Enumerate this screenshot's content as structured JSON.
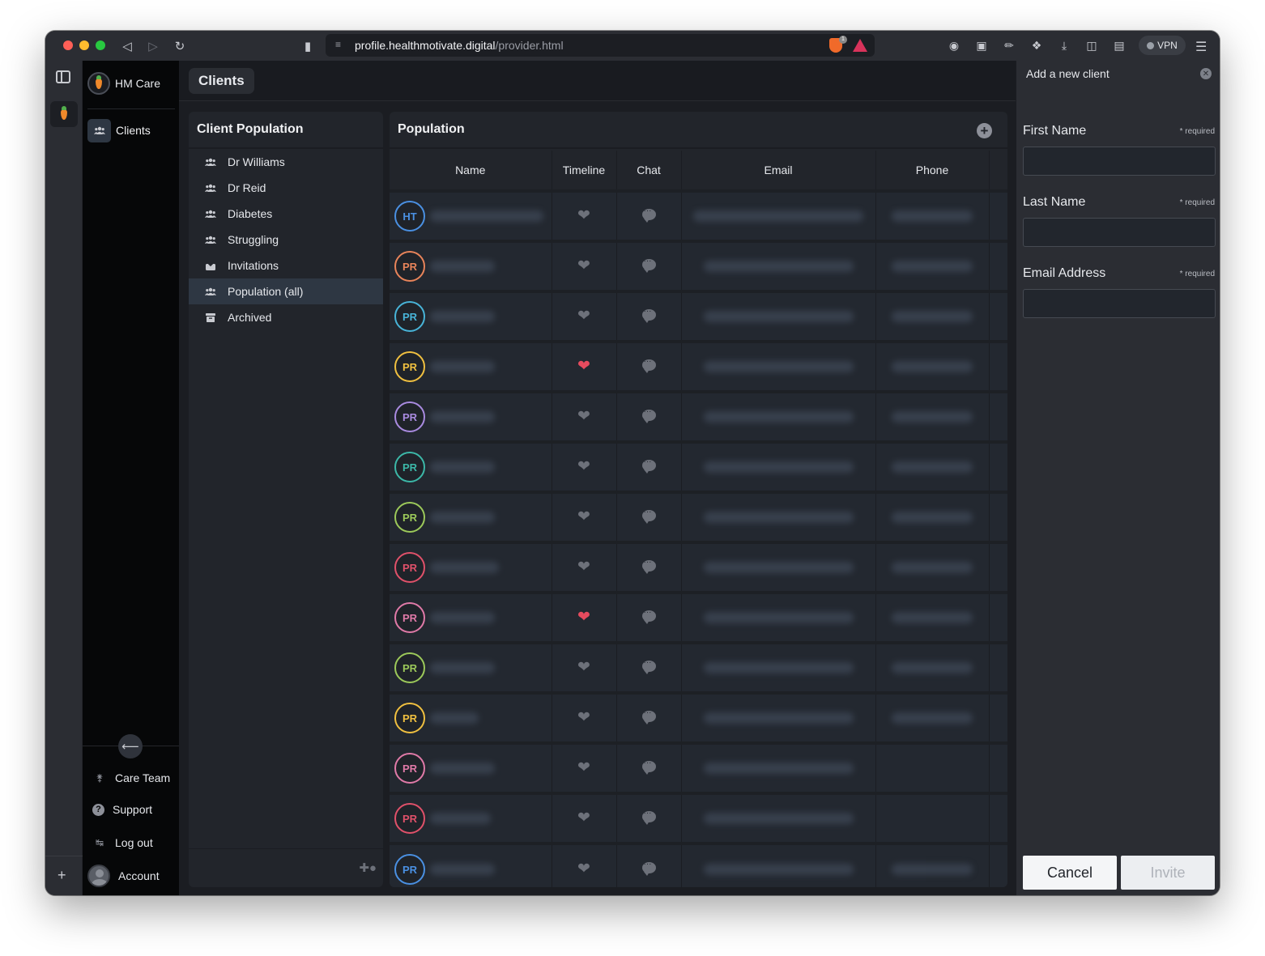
{
  "browser": {
    "url_host": "profile.healthmotivate.digital",
    "url_path": "/provider.html",
    "shield_count": "1",
    "vpn_label": "VPN"
  },
  "nav": {
    "brand": "HM Care",
    "clients": "Clients",
    "bottom": [
      {
        "label": "Care Team",
        "icon": "key-icon"
      },
      {
        "label": "Support",
        "icon": "help-icon"
      },
      {
        "label": "Log out",
        "icon": "logout-icon"
      },
      {
        "label": "Account",
        "icon": "avatar"
      }
    ]
  },
  "page": {
    "title": "Clients"
  },
  "client_population": {
    "title": "Client Population",
    "items": [
      {
        "label": "Dr Williams",
        "icon": "group-icon",
        "active": false
      },
      {
        "label": "Dr Reid",
        "icon": "group-icon",
        "active": false
      },
      {
        "label": "Diabetes",
        "icon": "group-icon",
        "active": false
      },
      {
        "label": "Struggling",
        "icon": "group-icon",
        "active": false
      },
      {
        "label": "Invitations",
        "icon": "inbox-icon",
        "active": false
      },
      {
        "label": "Population (all)",
        "icon": "group-icon",
        "active": true
      },
      {
        "label": "Archived",
        "icon": "archive-icon",
        "active": false
      }
    ]
  },
  "population": {
    "title": "Population",
    "columns": [
      "Name",
      "Timeline",
      "Chat",
      "Email",
      "Phone"
    ],
    "rows": [
      {
        "initials": "HT",
        "color": "#4a90e2",
        "timeline_active": false,
        "has_phone": true
      },
      {
        "initials": "PR",
        "color": "#e8845a",
        "timeline_active": false,
        "has_phone": true
      },
      {
        "initials": "PR",
        "color": "#48b4d8",
        "timeline_active": false,
        "has_phone": true
      },
      {
        "initials": "PR",
        "color": "#f0c040",
        "timeline_active": true,
        "has_phone": true
      },
      {
        "initials": "PR",
        "color": "#a98be0",
        "timeline_active": false,
        "has_phone": true
      },
      {
        "initials": "PR",
        "color": "#3cb8a8",
        "timeline_active": false,
        "has_phone": true
      },
      {
        "initials": "PR",
        "color": "#9cc95a",
        "timeline_active": false,
        "has_phone": true
      },
      {
        "initials": "PR",
        "color": "#e0516a",
        "timeline_active": false,
        "has_phone": true
      },
      {
        "initials": "PR",
        "color": "#e07aa8",
        "timeline_active": true,
        "has_phone": true
      },
      {
        "initials": "PR",
        "color": "#9cc95a",
        "timeline_active": false,
        "has_phone": true
      },
      {
        "initials": "PR",
        "color": "#f0c040",
        "timeline_active": false,
        "has_phone": true
      },
      {
        "initials": "PR",
        "color": "#e07aa8",
        "timeline_active": false,
        "has_phone": false
      },
      {
        "initials": "PR",
        "color": "#e0516a",
        "timeline_active": false,
        "has_phone": false
      },
      {
        "initials": "PR",
        "color": "#4a90e2",
        "timeline_active": false,
        "has_phone": true
      }
    ]
  },
  "add_client": {
    "title": "Add a new client",
    "required_note": "* required",
    "fields": [
      {
        "label": "First Name",
        "value": ""
      },
      {
        "label": "Last Name",
        "value": ""
      },
      {
        "label": "Email Address",
        "value": ""
      }
    ],
    "cancel_label": "Cancel",
    "invite_label": "Invite"
  }
}
